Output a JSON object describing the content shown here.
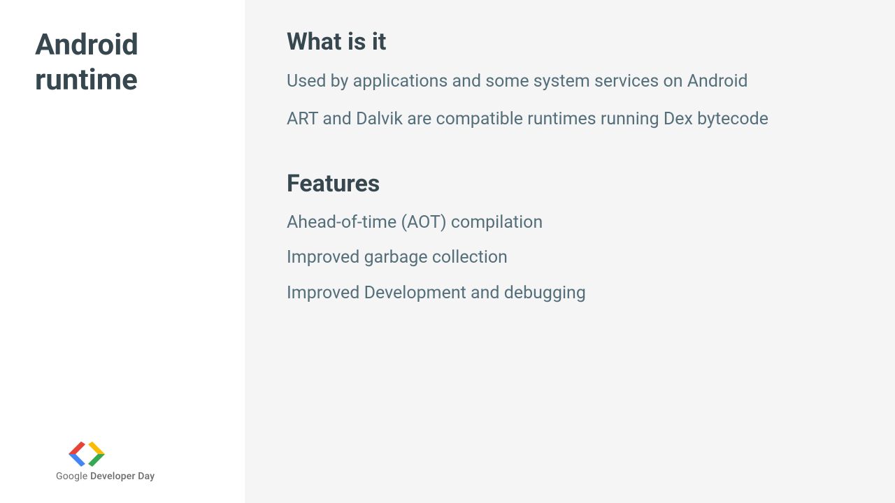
{
  "sidebar": {
    "title": "Android runtime",
    "footer": {
      "brand": "Google",
      "product": "Developer Day"
    }
  },
  "content": {
    "sections": [
      {
        "heading": "What is it",
        "paragraphs": [
          "Used by applications and some system services on Android",
          "ART and Dalvik are compatible runtimes running Dex bytecode"
        ]
      },
      {
        "heading": "Features",
        "items": [
          "Ahead-of-time (AOT) compilation",
          "Improved garbage collection",
          "Improved Development and debugging"
        ]
      }
    ]
  }
}
